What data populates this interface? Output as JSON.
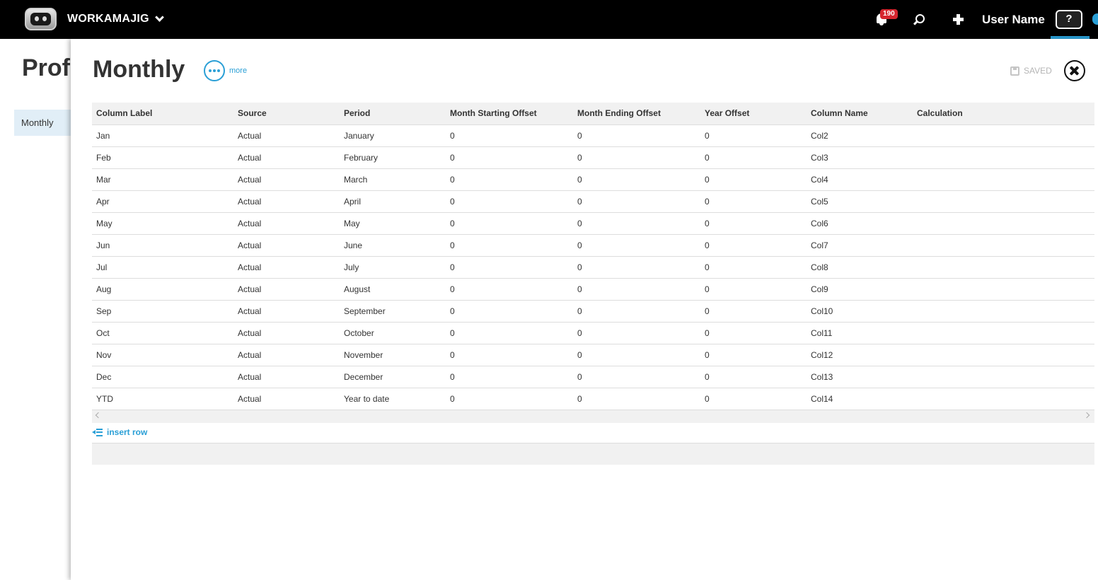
{
  "topbar": {
    "app_name": "WORKAMAJIG",
    "notification_count": "190",
    "user_name": "User Name",
    "help_label": "?"
  },
  "background_page": {
    "title": "Profi",
    "nav_item": "Monthly"
  },
  "panel": {
    "title": "Monthly",
    "more_label": "more",
    "saved_label": "SAVED"
  },
  "grid": {
    "columns": [
      "Column Label",
      "Source",
      "Period",
      "Month Starting Offset",
      "Month Ending Offset",
      "Year Offset",
      "Column Name",
      "Calculation"
    ],
    "rows": [
      [
        "Jan",
        "Actual",
        "January",
        "0",
        "0",
        "0",
        "Col2",
        ""
      ],
      [
        "Feb",
        "Actual",
        "February",
        "0",
        "0",
        "0",
        "Col3",
        ""
      ],
      [
        "Mar",
        "Actual",
        "March",
        "0",
        "0",
        "0",
        "Col4",
        ""
      ],
      [
        "Apr",
        "Actual",
        "April",
        "0",
        "0",
        "0",
        "Col5",
        ""
      ],
      [
        "May",
        "Actual",
        "May",
        "0",
        "0",
        "0",
        "Col6",
        ""
      ],
      [
        "Jun",
        "Actual",
        "June",
        "0",
        "0",
        "0",
        "Col7",
        ""
      ],
      [
        "Jul",
        "Actual",
        "July",
        "0",
        "0",
        "0",
        "Col8",
        ""
      ],
      [
        "Aug",
        "Actual",
        "August",
        "0",
        "0",
        "0",
        "Col9",
        ""
      ],
      [
        "Sep",
        "Actual",
        "September",
        "0",
        "0",
        "0",
        "Col10",
        ""
      ],
      [
        "Oct",
        "Actual",
        "October",
        "0",
        "0",
        "0",
        "Col11",
        ""
      ],
      [
        "Nov",
        "Actual",
        "November",
        "0",
        "0",
        "0",
        "Col12",
        ""
      ],
      [
        "Dec",
        "Actual",
        "December",
        "0",
        "0",
        "0",
        "Col13",
        ""
      ],
      [
        "YTD",
        "Actual",
        "Year to date",
        "0",
        "0",
        "0",
        "Col14",
        ""
      ]
    ],
    "insert_row_label": "insert row"
  },
  "colors": {
    "accent": "#2a9fd6",
    "badge": "#d6262f",
    "topbar": "#000000"
  }
}
